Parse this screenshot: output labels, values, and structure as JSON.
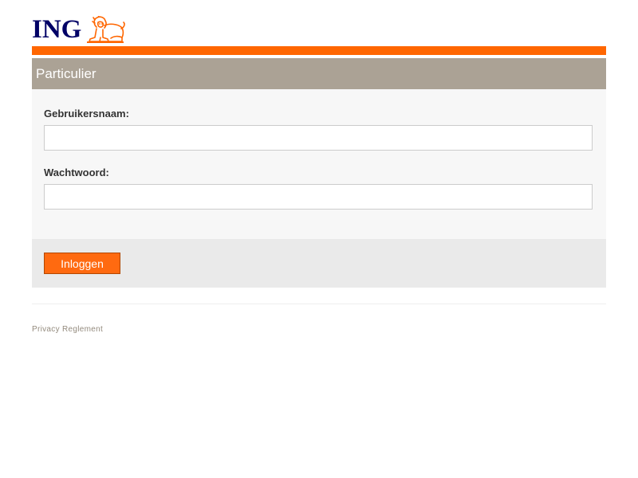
{
  "brand": {
    "name": "ING",
    "logo_icon": "lion-icon",
    "accent_color": "#ff6600",
    "text_color": "#000066"
  },
  "panel": {
    "title": "Particulier",
    "username_label": "Gebruikersnaam:",
    "username_value": "",
    "password_label": "Wachtwoord:",
    "password_value": "",
    "login_button_label": "Inloggen"
  },
  "footer": {
    "privacy_link": "Privacy Reglement"
  }
}
